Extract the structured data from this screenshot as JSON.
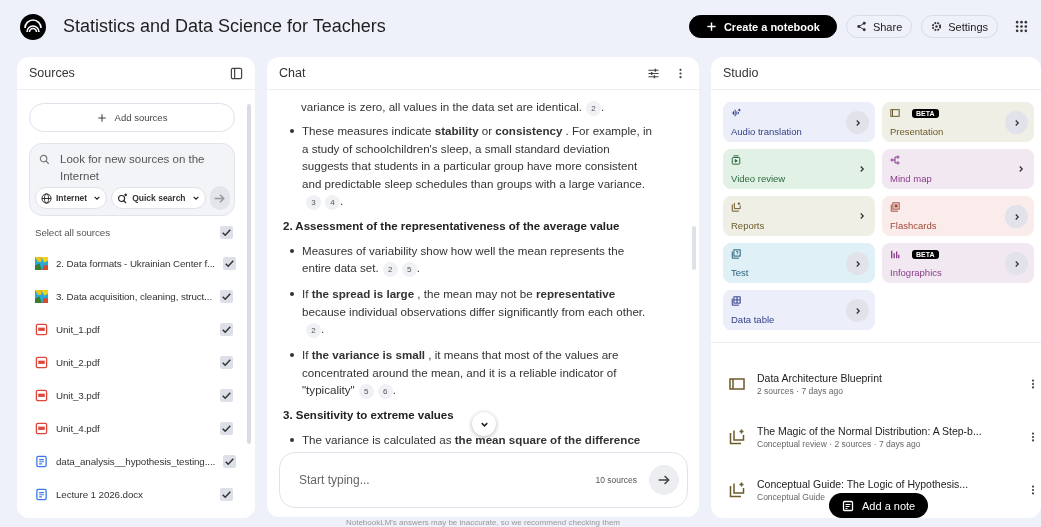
{
  "header": {
    "title": "Statistics and Data Science for Teachers",
    "buttons": [
      {
        "kind": "create",
        "label": "Create a notebook"
      },
      {
        "kind": "share",
        "label": "Share"
      },
      {
        "kind": "settings",
        "label": "Settings"
      }
    ]
  },
  "sources": {
    "title": "Sources",
    "add_label": "Add sources",
    "search": {
      "placeholder": "Look for new sources on the Internet",
      "chips": [
        {
          "kind": "globe",
          "label": "Internet"
        },
        {
          "kind": "quick",
          "label": "Quick search"
        }
      ]
    },
    "select_all": {
      "label": "Select all sources",
      "checked": true
    },
    "items": [
      {
        "kind": "image",
        "name": "2. Data formats - Ukrainian Center f...",
        "checked": true
      },
      {
        "kind": "image",
        "name": "3. Data acquisition, cleaning, struct...",
        "checked": true
      },
      {
        "kind": "pdf",
        "name": "Unit_1.pdf",
        "checked": true
      },
      {
        "kind": "pdf",
        "name": "Unit_2.pdf",
        "checked": true
      },
      {
        "kind": "pdf",
        "name": "Unit_3.pdf",
        "checked": true
      },
      {
        "kind": "pdf",
        "name": "Unit_4.pdf",
        "checked": true
      },
      {
        "kind": "doc",
        "name": "data_analysis__hypothesis_testing....",
        "checked": true
      },
      {
        "kind": "doc",
        "name": "Lecture 1  2026.docx",
        "checked": true
      }
    ]
  },
  "chat": {
    "title": "Chat",
    "blocks": [
      {
        "kind": "continuation",
        "text": "variance is zero, all values in the data set are identical.",
        "citations": [
          "2"
        ],
        "after": "."
      },
      {
        "kind": "bullet",
        "text": "These measures indicate **stability** or **consistency** . For example, in a study of schoolchildren's sleep, a small standard deviation suggests that students in a particular group have more consistent and predictable sleep schedules than groups with a large variance.",
        "citations": [
          "3",
          "4"
        ],
        "after": "."
      },
      {
        "kind": "heading",
        "text": "2. Assessment of the representativeness of the average value"
      },
      {
        "kind": "bullet",
        "text": "Measures of variability show how well the mean represents the entire data set.",
        "citations": [
          "2",
          "5"
        ],
        "after": "."
      },
      {
        "kind": "bullet",
        "text": "If **the spread is large** , the mean may not be **representative** because individual observations differ significantly from each other.",
        "citations": [
          "2"
        ],
        "after": "."
      },
      {
        "kind": "bullet",
        "text": "If **the variance is small** , it means that most of the values are concentrated around the mean, and it is a reliable indicator of \"typicality\"",
        "citations": [
          "5",
          "6"
        ],
        "after": "."
      },
      {
        "kind": "heading",
        "text": "3. Sensitivity to extreme values"
      },
      {
        "kind": "bullet",
        "text": "The variance is calculated as **the mean square of the difference**"
      }
    ],
    "input": {
      "placeholder": "Start typing...",
      "count": "10 sources"
    },
    "disclaimer": "NotebookLM's answers may be inaccurate, so we recommend checking them"
  },
  "studio": {
    "title": "Studio",
    "tiles": [
      {
        "kind": "audio",
        "label": "Audio translation",
        "color": "#eceefa",
        "arrow_in_circle": true
      },
      {
        "kind": "video",
        "label": "Video review",
        "color": "#e2f1e5",
        "arrow_in_circle": false
      },
      {
        "kind": "reports",
        "label": "Reports",
        "color": "#f0efe6",
        "arrow_in_circle": false
      },
      {
        "kind": "test",
        "label": "Test",
        "color": "#dff0f6",
        "arrow_in_circle": true
      },
      {
        "kind": "table",
        "label": "Data table",
        "color": "#eceefa",
        "arrow_in_circle": true
      },
      {
        "kind": "presentation",
        "label": "Presentation",
        "color": "#f0efe6",
        "badge": "BETA",
        "arrow_in_circle": true
      },
      {
        "kind": "mindmap",
        "label": "Mind map",
        "color": "#f1e8f1",
        "arrow_in_circle": false
      },
      {
        "kind": "flashcards",
        "label": "Flashcards",
        "color": "#f9ecea",
        "arrow_in_circle": true
      },
      {
        "kind": "infographics",
        "label": "Infographics",
        "color": "#f1e8f1",
        "badge": "BETA",
        "arrow_in_circle": true
      }
    ],
    "notes": [
      {
        "kind": "presentation",
        "title": "Data Architecture Blueprint",
        "meta": "2 sources · 7 days ago"
      },
      {
        "kind": "reports",
        "title": "The Magic of the Normal Distribution: A Step-b...",
        "meta": "Conceptual review · 2 sources · 7 days ago"
      },
      {
        "kind": "reports",
        "title": "Conceptual Guide: The Logic of Hypothesis...",
        "meta": "Conceptual Guide"
      }
    ],
    "add_note": "Add a note"
  }
}
